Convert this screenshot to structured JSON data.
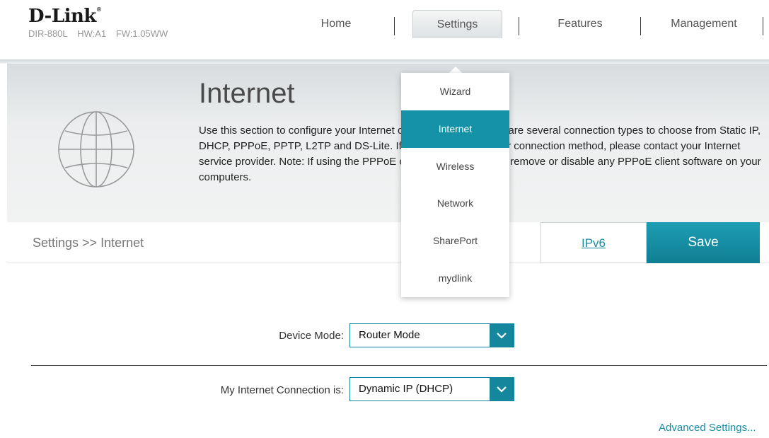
{
  "header": {
    "brand": "D-Link",
    "brand_mark": "®",
    "model": "DIR-880L",
    "hw": "HW:A1",
    "fw": "FW:1.05WW"
  },
  "nav": {
    "items": [
      {
        "label": "Home"
      },
      {
        "label": "Settings"
      },
      {
        "label": "Features"
      },
      {
        "label": "Management"
      }
    ],
    "active": "Settings"
  },
  "settings_menu": {
    "items": [
      {
        "label": "Wizard"
      },
      {
        "label": "Internet"
      },
      {
        "label": "Wireless"
      },
      {
        "label": "Network"
      },
      {
        "label": "SharePort"
      },
      {
        "label": "mydlink"
      }
    ],
    "active": "Internet"
  },
  "banner": {
    "title": "Internet",
    "description": "Use this section to configure your Internet connection type. There are several connection types to choose from Static IP, DHCP, PPPoE, PPTP, L2TP and DS-Lite. If you are unsure of your connection method, please contact your Internet service provider. Note: If using the PPPoE option, you will need to remove or disable any PPPoE client software on your computers.",
    "icon": "globe-icon"
  },
  "breadcrumb": "Settings >> Internet",
  "actions": {
    "ipv6_label": "IPv6",
    "save_label": "Save"
  },
  "form": {
    "device_mode_label": "Device Mode:",
    "device_mode_value": "Router Mode",
    "connection_label": "My Internet Connection is:",
    "connection_value": "Dynamic IP (DHCP)",
    "advanced_label": "Advanced Settings..."
  },
  "colors": {
    "accent": "#1692a8",
    "link": "#1a8aa3"
  }
}
